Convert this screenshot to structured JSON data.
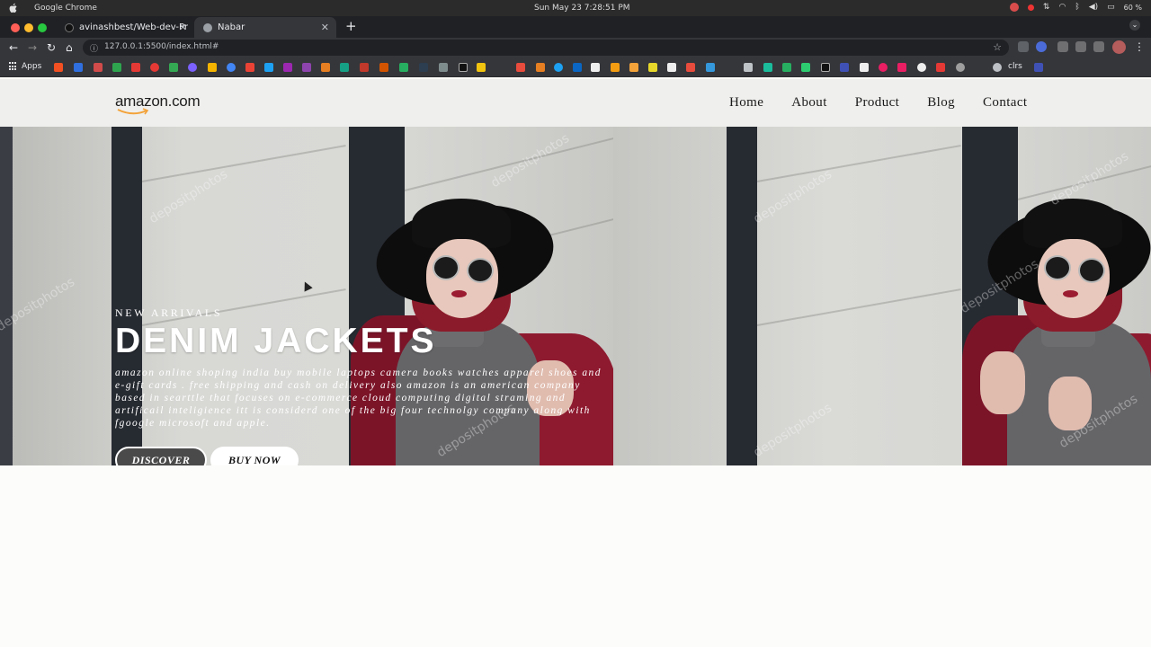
{
  "os": {
    "app_name": "Google Chrome",
    "clock": "Sun May 23   7:28:51 PM",
    "battery": "60 %"
  },
  "browser": {
    "tabs": [
      {
        "label": "avinashbest/Web-dev-Pr",
        "active": false
      },
      {
        "label": "Nabar",
        "active": true
      }
    ],
    "new_tab": "+",
    "url": "127.0.0.1:5500/index.html#",
    "bookmarks_apps": "Apps",
    "bookmark_text": "clrs"
  },
  "site": {
    "logo_text": "amazon.com",
    "nav": [
      "Home",
      "About",
      "Product",
      "Blog",
      "Contact"
    ],
    "hero": {
      "eyebrow": "NEW ARRIVALS",
      "headline": "DENIM JACKETS",
      "description": "amazon online shoping india buy mobile laptops camera books watches apparel shoes and e-gift cards . free shipping and cash on delivery also amazon is an american company based in searttle that focuses on e-commerce cloud computing digital straming and artificail inteligience itt is considerd one of the big four technolgy company along with fgoogle microsoft and apple.",
      "buttons": {
        "discover": "DISCOVER",
        "buy": "BUY NOW"
      },
      "watermark": "depositphotos"
    }
  },
  "colors": {
    "brand_orange": "#f3a33a",
    "coat": "#8e1a2f"
  }
}
